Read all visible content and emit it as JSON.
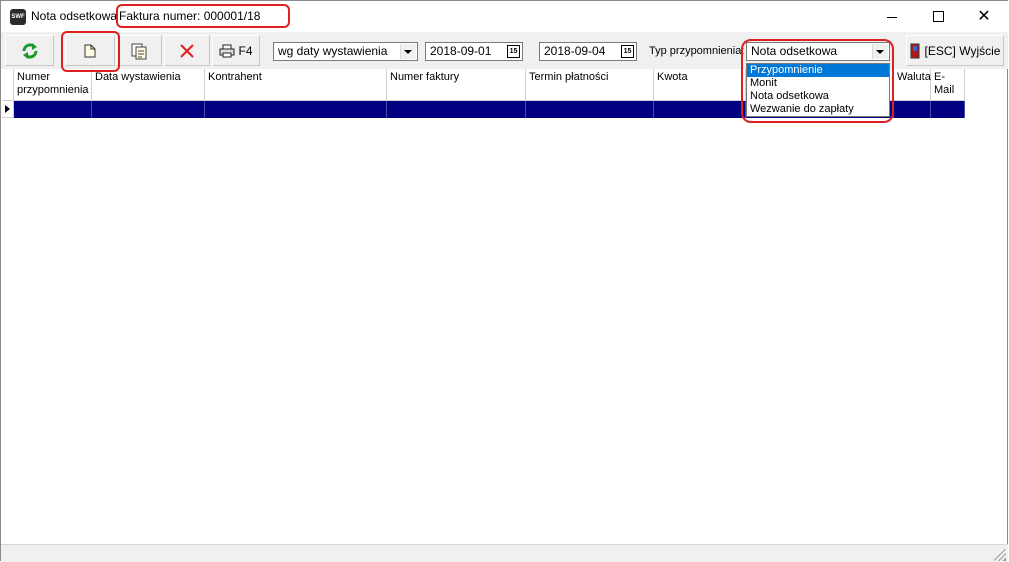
{
  "window": {
    "app_icon_text": "SWF",
    "title": "Nota odsetkowa",
    "subtitle": "Faktura numer: 000001/18",
    "close_glyph": "✕"
  },
  "toolbar": {
    "refresh_icon": "refresh-icon",
    "new_icon": "new-document-icon",
    "export_icon": "export-icon",
    "delete_icon": "delete-icon",
    "print_label": "F4",
    "date_mode": "wg daty wystawienia",
    "date_from": "2018-09-01",
    "date_sep": "-",
    "date_to": "2018-09-04",
    "cal_glyph": "15",
    "type_label": "Typ przypomnienia:",
    "type_value": "Nota odsetkowa",
    "exit_label": "[ESC] Wyjście"
  },
  "dropdown": {
    "options": [
      "Przypomnienie",
      "Monit",
      "Nota odsetkowa",
      "Wezwanie do zapłaty"
    ],
    "selected_index": 0
  },
  "grid": {
    "columns": [
      "Numer przypomnienia",
      "Data wystawienia",
      "Kontrahent",
      "Numer faktury",
      "Termin płatności",
      "Kwota",
      "",
      "Waluta",
      "E-Mail"
    ]
  },
  "colors": {
    "selection_row": "#000080",
    "highlight": "#e02020",
    "list_selected": "#0078d7"
  }
}
